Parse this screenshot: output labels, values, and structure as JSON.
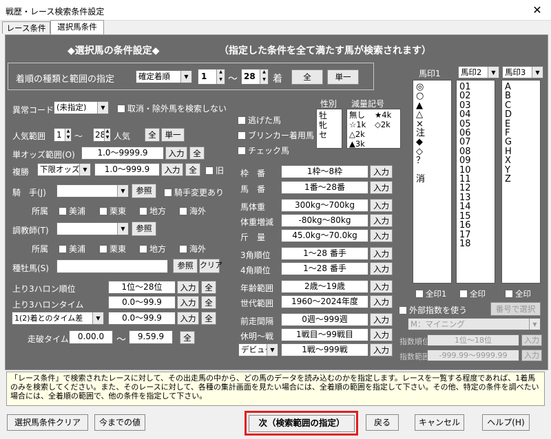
{
  "window": {
    "title": "戦歴・レース検索条件設定",
    "close": "✕"
  },
  "tabs": [
    {
      "label": "レース条件"
    },
    {
      "label": "選択馬条件"
    }
  ],
  "header": {
    "title": "◆選択馬の条件設定◆",
    "subtitle": "（指定した条件を全て満たす馬が検索されます）"
  },
  "finish": {
    "label": "着順の種類と範囲の指定",
    "type": "確定着順",
    "from": "1",
    "to": "28",
    "sep": "～",
    "unit": "着",
    "all": "全",
    "single": "単一"
  },
  "abnormal": {
    "label": "異常コード",
    "value": "(未指定)",
    "cancel_label": "取消・除外馬を検索しない"
  },
  "popularity": {
    "label": "人気範囲",
    "from": "1",
    "to": "28",
    "sep": "～",
    "unit": "人気",
    "all": "全",
    "single": "単一"
  },
  "win_odds": {
    "label": "単オッズ範囲(O)",
    "value": "1.0～9999.9",
    "input": "入力",
    "all": "全"
  },
  "place": {
    "label": "複勝",
    "type": "下限オッズ",
    "value": "1.0～999.9",
    "input": "入力",
    "all": "全",
    "old": "旧"
  },
  "jockey": {
    "label": "騎　手(J)",
    "ref": "参照",
    "change": "騎手変更あり",
    "affil_label": "所属",
    "affil": [
      "美浦",
      "栗東",
      "地方",
      "海外"
    ]
  },
  "trainer": {
    "label": "調教師(T)",
    "ref": "参照",
    "affil_label": "所属",
    "affil": [
      "美浦",
      "栗東",
      "地方",
      "海外"
    ]
  },
  "sire": {
    "label": "種牡馬(S)",
    "ref": "参照",
    "clear": "クリア"
  },
  "last3f_rank": {
    "label": "上り3ハロン順位",
    "value": "1位～28位",
    "input": "入力",
    "all": "全"
  },
  "last3f_time": {
    "label": "上り3ハロンタイム",
    "value": "0.0～99.9",
    "input": "入力",
    "all": "全"
  },
  "diff": {
    "label": "1(2)着とのタイム差",
    "value": "0.0～99.9",
    "input": "入力",
    "all": "全"
  },
  "runtime": {
    "label": "走破タイム",
    "from": "0.00.0",
    "sep": "～",
    "to": "9.59.9",
    "all": "全"
  },
  "flags": {
    "escaped": "逃げた馬",
    "blinker": "ブリンカー着用馬",
    "check": "チェック馬"
  },
  "sex": {
    "label": "性別",
    "items": [
      "牡",
      "牝",
      "セ"
    ]
  },
  "weight_mark": {
    "label": "減量記号",
    "items": [
      "無し",
      "☆1k",
      "△2k",
      "▲3k",
      "★4k",
      "◇2k"
    ]
  },
  "ranges": [
    {
      "label": "枠　番",
      "value": "1枠～8枠",
      "input": "入力"
    },
    {
      "label": "馬　番",
      "value": "1番～28番",
      "input": "入力"
    },
    {
      "label": "馬体重",
      "value": "300kg～700kg",
      "input": "入力"
    },
    {
      "label": "体重増減",
      "value": "-80kg～80kg",
      "input": "入力"
    },
    {
      "label": "斤　量",
      "value": "45.0kg～70.0kg",
      "input": "入力"
    },
    {
      "label": "3角順位",
      "value": "1～28 番手",
      "input": "入力"
    },
    {
      "label": "4角順位",
      "value": "1～28 番手",
      "input": "入力"
    },
    {
      "label": "年齢範囲",
      "value": "2歳～19歳",
      "input": "入力"
    },
    {
      "label": "世代範囲",
      "value": "1960～2024年度",
      "input": "入力"
    },
    {
      "label": "前走間隔",
      "value": "0週～999週",
      "input": "入力"
    },
    {
      "label": "休明～戦",
      "value": "1戦目～99戦目",
      "input": "入力"
    },
    {
      "label": "デビュー",
      "value": "1戦～999戦",
      "input": "入力"
    }
  ],
  "mark1": {
    "label": "馬印1",
    "items": [
      "◎",
      "○",
      "▲",
      "△",
      "×",
      "注",
      "◆",
      "◇",
      "？",
      "",
      "消"
    ],
    "all": "全印1"
  },
  "mark2": {
    "label": "馬印2",
    "items": [
      "01",
      "02",
      "03",
      "04",
      "05",
      "06",
      "07",
      "08",
      "09",
      "10",
      "11",
      "12",
      "13",
      "14",
      "15",
      "16",
      "17",
      "18"
    ],
    "all": "全印"
  },
  "mark3": {
    "label": "馬印3",
    "items": [
      "A",
      "B",
      "C",
      "D",
      "E",
      "F",
      "G",
      "H",
      "X",
      "Y",
      "Z"
    ],
    "all": "全印"
  },
  "external": {
    "label": "外部指数を使う",
    "select_btn": "番号で選択",
    "index": "M：マイニング",
    "rank_label": "指数順位",
    "rank_value": "1位～18位",
    "range_label": "指数範囲",
    "range_value": "-999.99～9999.99",
    "input": "入力"
  },
  "notes": {
    "text": "「レース条件」で検索されたレースに対して、その出走馬の中から、どの馬のデータを読み込むのかを指定します。レースを一覧する程度であれば、1着馬のみを検索してください。また、そのレースに対して、各種の集計画面を見たい場合には、全着順の範囲を指定して下さい。その他、特定の条件を調べたい場合には、全着順の範囲で、他の条件を指定して下さい。"
  },
  "footer": {
    "clear": "選択馬条件クリア",
    "prev": "今までの値",
    "next": "次（検索範囲の指定）",
    "back": "戻る",
    "cancel": "キャンセル",
    "help": "ヘルプ(H)"
  },
  "colors": {
    "panel": "#6b6b6b",
    "highlight": "#e02020"
  }
}
